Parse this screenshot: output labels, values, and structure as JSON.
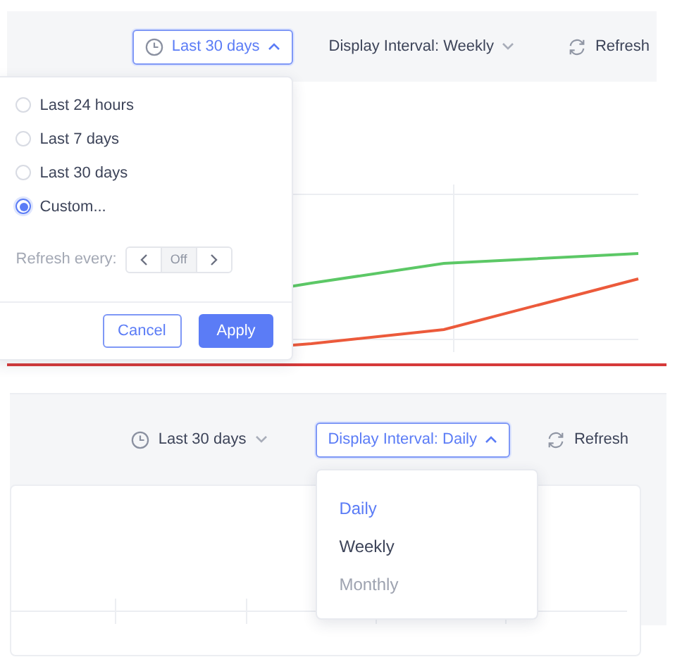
{
  "panels": [
    {
      "range_button": {
        "label": "Last 30 days",
        "expanded": true
      },
      "interval_button": {
        "label": "Display Interval: Weekly",
        "expanded": false
      },
      "refresh_button": {
        "label": "Refresh"
      },
      "chart": {
        "kind": "lines"
      },
      "range_menu": {
        "options": [
          {
            "label": "Last 24 hours",
            "selected": false
          },
          {
            "label": "Last 7 days",
            "selected": false
          },
          {
            "label": "Last 30 days",
            "selected": false
          },
          {
            "label": "Custom...",
            "selected": true
          }
        ],
        "refresh": {
          "label": "Refresh every:",
          "value": "Off",
          "disabled": true
        },
        "cancel": "Cancel",
        "apply": "Apply"
      }
    },
    {
      "range_button": {
        "label": "Last 30 days",
        "expanded": false
      },
      "interval_button": {
        "label": "Display Interval: Daily",
        "expanded": true
      },
      "refresh_button": {
        "label": "Refresh"
      },
      "chart": {
        "kind": "grid"
      },
      "interval_menu": {
        "options": [
          {
            "label": "Daily",
            "selected": true,
            "disabled": false
          },
          {
            "label": "Weekly",
            "selected": false,
            "disabled": false
          },
          {
            "label": "Monthly",
            "selected": false,
            "disabled": true
          }
        ]
      }
    }
  ]
}
